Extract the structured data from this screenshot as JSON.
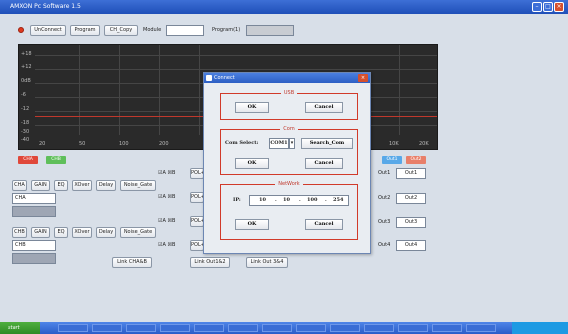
{
  "window": {
    "title": "AMXON Pc Software 1.5"
  },
  "toolbar": {
    "unconnect": "UnConnect",
    "program": "Program",
    "ch_copy": "CH_Copy",
    "module_label": "Module",
    "module_value": "",
    "program_label": "Program(1)",
    "program_value": ""
  },
  "graph": {
    "y_ticks": [
      "+18",
      "+12",
      "0dB",
      "-6",
      "-12",
      "-18",
      "-30",
      "-40"
    ],
    "x_ticks": [
      "20",
      "50",
      "100",
      "200",
      "10K",
      "20K"
    ]
  },
  "tags": {
    "cha": "CHA",
    "chb": "CHB",
    "out1": "Out1",
    "out2": "Out2"
  },
  "cha_tabs": [
    "CHA",
    "GAIN",
    "EQ",
    "XOver",
    "Delay",
    "Noise_Gate"
  ],
  "chb_tabs": [
    "CHB",
    "GAIN",
    "EQ",
    "XOver",
    "Delay",
    "Noise_Gate"
  ],
  "cha_name": "CHA",
  "chb_name": "CHB",
  "routing": {
    "a_label": "A",
    "b_label": "B",
    "pol_label": "POL+",
    "link_ab": "Link CHA&B",
    "link_12": "Link Out1&2",
    "link_34": "Link Out 3&4"
  },
  "outputs": [
    {
      "label": "Out1",
      "value": "Out1"
    },
    {
      "label": "Out2",
      "value": "Out2"
    },
    {
      "label": "Out3",
      "value": "Out3"
    },
    {
      "label": "Out4",
      "value": "Out4"
    }
  ],
  "dialog": {
    "title": "Connect",
    "usb": {
      "title": "USB",
      "ok": "OK",
      "cancel": "Cancel"
    },
    "com": {
      "title": "Com",
      "select_label": "Com Select:",
      "select_value": "COM1",
      "search": "Search_Com",
      "ok": "OK",
      "cancel": "Cancel"
    },
    "network": {
      "title": "NetWork",
      "ip_label": "IP:",
      "ip": [
        "10",
        "10",
        "100",
        "254"
      ],
      "ok": "OK",
      "cancel": "Cancel"
    }
  },
  "taskbar": {
    "start": "start",
    "tasks": [
      "",
      "",
      "",
      "",
      "",
      "",
      "",
      "",
      "",
      "",
      "",
      "",
      "",
      ""
    ],
    "clock": ""
  },
  "colors": {
    "accent_red": "#d13a2a",
    "title_blue": "#2d5fc4",
    "graph_bg": "#2a2a2a",
    "cha_tag": "#e0483a",
    "chb_tag": "#5fbf5a",
    "out_tag": "#58a8e8"
  }
}
